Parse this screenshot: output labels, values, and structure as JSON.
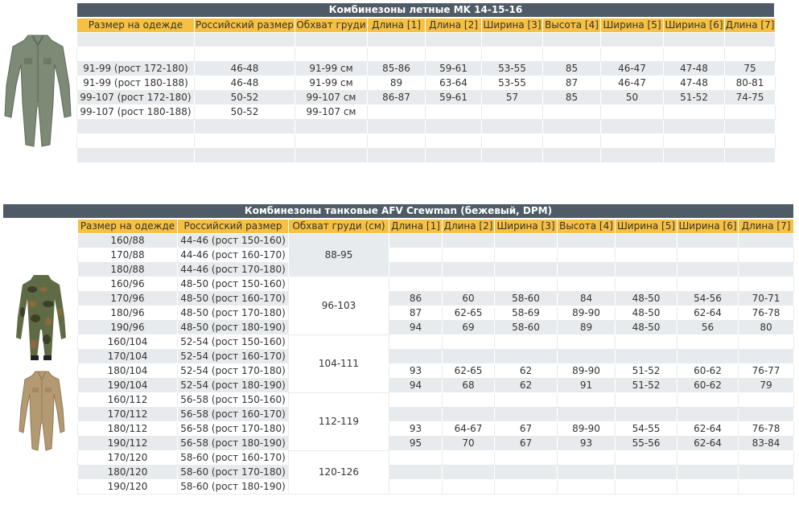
{
  "flight": {
    "title": "Комбинезоны летные MK 14-15-16",
    "headers": [
      "Размер на одежде",
      "Российский размер",
      "Обхват груди",
      "Длина [1]",
      "Длина [2]",
      "Ширина [3]",
      "Высота [4]",
      "Ширина [5]",
      "Ширина [6]",
      "Длина [7]"
    ],
    "rows": [
      [
        "",
        "",
        "",
        "",
        "",
        "",
        "",
        "",
        "",
        ""
      ],
      [
        "",
        "",
        "",
        "",
        "",
        "",
        "",
        "",
        "",
        ""
      ],
      [
        "91-99 (рост 172-180)",
        "46-48",
        "91-99 см",
        "85-86",
        "59-61",
        "53-55",
        "85",
        "46-47",
        "47-48",
        "75"
      ],
      [
        "91-99 (рост 180-188)",
        "46-48",
        "91-99 см",
        "89",
        "63-64",
        "53-55",
        "87",
        "46-47",
        "47-48",
        "80-81"
      ],
      [
        "99-107 (рост 172-180)",
        "50-52",
        "99-107 см",
        "86-87",
        "59-61",
        "57",
        "85",
        "50",
        "51-52",
        "74-75"
      ],
      [
        "99-107 (рост 180-188)",
        "50-52",
        "99-107 см",
        "",
        "",
        "",
        "",
        "",
        "",
        ""
      ],
      [
        "",
        "",
        "",
        "",
        "",
        "",
        "",
        "",
        "",
        ""
      ],
      [
        "",
        "",
        "",
        "",
        "",
        "",
        "",
        "",
        "",
        ""
      ],
      [
        "",
        "",
        "",
        "",
        "",
        "",
        "",
        "",
        "",
        ""
      ]
    ]
  },
  "tank": {
    "title": "Комбинезоны танковые AFV Crewman (бежевый, DPM)",
    "headers": [
      "Размер на одежде",
      "Российский размер",
      "Обхват груди (см)",
      "Длина [1]",
      "Длина [2]",
      "Ширина [3]",
      "Высота [4]",
      "Ширина [5]",
      "Ширина [6]",
      "Длина [7]"
    ],
    "rows": [
      [
        "160/88",
        "44-46 (рост 150-160)",
        "",
        "",
        "",
        "",
        "",
        "",
        ""
      ],
      [
        "170/88",
        "44-46 (рост 160-170)",
        "",
        "",
        "",
        "",
        "",
        "",
        ""
      ],
      [
        "180/88",
        "44-46 (рост 170-180)",
        "",
        "",
        "",
        "",
        "",
        "",
        ""
      ],
      [
        "160/96",
        "48-50 (рост 150-160)",
        "",
        "",
        "",
        "",
        "",
        "",
        ""
      ],
      [
        "170/96",
        "48-50 (рост 160-170)",
        "86",
        "60",
        "58-60",
        "84",
        "48-50",
        "54-56",
        "70-71"
      ],
      [
        "180/96",
        "48-50 (рост 170-180)",
        "87",
        "62-65",
        "58-69",
        "89-90",
        "48-50",
        "62-64",
        "76-78"
      ],
      [
        "190/96",
        "48-50 (рост 180-190)",
        "94",
        "69",
        "58-60",
        "89",
        "48-50",
        "56",
        "80"
      ],
      [
        "160/104",
        "52-54 (рост 150-160)",
        "",
        "",
        "",
        "",
        "",
        "",
        ""
      ],
      [
        "170/104",
        "52-54 (рост 160-170)",
        "",
        "",
        "",
        "",
        "",
        "",
        ""
      ],
      [
        "180/104",
        "52-54 (рост 170-180)",
        "93",
        "62-65",
        "62",
        "89-90",
        "51-52",
        "60-62",
        "76-77"
      ],
      [
        "190/104",
        "52-54 (рост 180-190)",
        "94",
        "68",
        "62",
        "91",
        "51-52",
        "60-62",
        "79"
      ],
      [
        "160/112",
        "56-58 (рост 150-160)",
        "",
        "",
        "",
        "",
        "",
        "",
        ""
      ],
      [
        "170/112",
        "56-58 (рост 160-170)",
        "",
        "",
        "",
        "",
        "",
        "",
        ""
      ],
      [
        "180/112",
        "56-58 (рост 170-180)",
        "93",
        "64-67",
        "67",
        "89-90",
        "54-55",
        "62-64",
        "76-78"
      ],
      [
        "190/112",
        "56-58 (рост 180-190)",
        "95",
        "70",
        "67",
        "93",
        "55-56",
        "62-64",
        "83-84"
      ],
      [
        "170/120",
        "58-60 (рост 160-170)",
        "",
        "",
        "",
        "",
        "",
        "",
        ""
      ],
      [
        "180/120",
        "58-60 (рост 170-180)",
        "",
        "",
        "",
        "",
        "",
        "",
        ""
      ],
      [
        "190/120",
        "58-60 (рост 180-190)",
        "",
        "",
        "",
        "",
        "",
        "",
        ""
      ]
    ],
    "chest_groups": [
      {
        "label": "88-95",
        "span": 3
      },
      {
        "label": "96-103",
        "span": 4
      },
      {
        "label": "104-111",
        "span": 4
      },
      {
        "label": "112-119",
        "span": 4
      },
      {
        "label": "120-126",
        "span": 3
      }
    ]
  },
  "colors": {
    "header_bg": "#f6c042",
    "title_bg": "#4f5b66",
    "row_alt": "#e8ebed"
  },
  "images": {
    "flight_photo": "olive-flight-coverall-image",
    "camo_photo": "camouflage-dpm-coverall-image",
    "beige_photo": "beige-tank-coverall-image"
  }
}
